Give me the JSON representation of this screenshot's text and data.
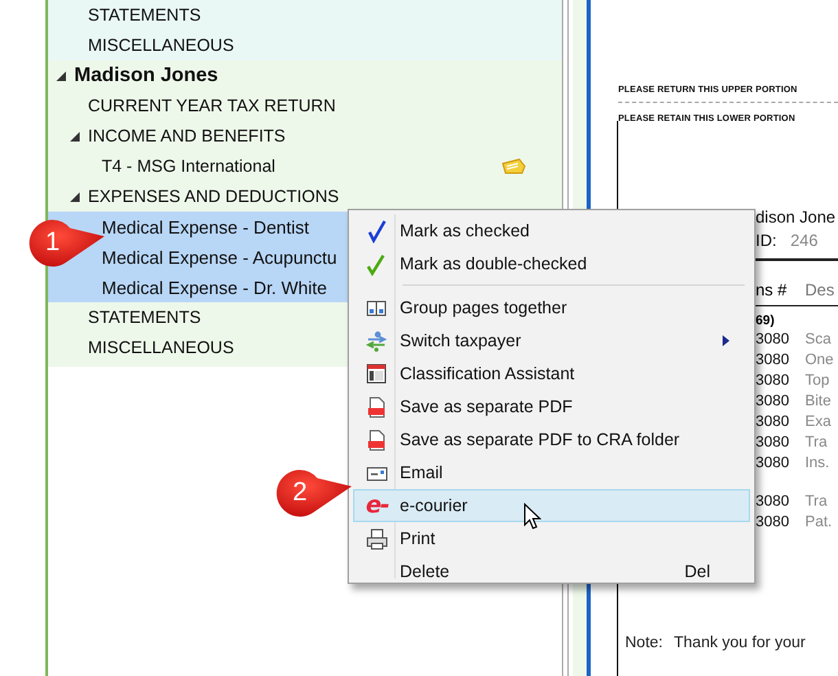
{
  "tree": {
    "previous_items": [
      {
        "label": "STATEMENTS",
        "selected": false
      },
      {
        "label": "MISCELLANEOUS",
        "selected": false
      }
    ],
    "taxpayers": [
      {
        "label": "Madison Jones",
        "expanded": true,
        "selected": false,
        "children": [
          {
            "label": "CURRENT YEAR TAX RETURN",
            "selected": false
          },
          {
            "label": "INCOME AND BENEFITS",
            "expanded": true,
            "selected": false,
            "children": [
              {
                "label": "T4 - MSG International",
                "selected": false,
                "tagged": true
              }
            ]
          },
          {
            "label": "EXPENSES AND DEDUCTIONS",
            "expanded": true,
            "selected": false,
            "children": [
              {
                "label": "Medical Expense - Dentist",
                "selected": true
              },
              {
                "label": "Medical Expense - Acupunctu",
                "selected": true
              },
              {
                "label": "Medical Expense - Dr. White",
                "selected": true
              }
            ]
          },
          {
            "label": "STATEMENTS",
            "selected": false
          },
          {
            "label": "MISCELLANEOUS",
            "selected": false
          }
        ]
      }
    ]
  },
  "context_menu": {
    "items": [
      {
        "kind": "check",
        "label": "Mark as checked",
        "selected": false
      },
      {
        "kind": "doublecheck",
        "label": "Mark as double-checked",
        "selected": false
      },
      {
        "kind": "separator"
      },
      {
        "kind": "group",
        "label": "Group pages together",
        "selected": false
      },
      {
        "kind": "switch",
        "label": "Switch taxpayer",
        "submenu": true,
        "selected": false
      },
      {
        "kind": "classify",
        "label": "Classification Assistant",
        "selected": false
      },
      {
        "kind": "pdf",
        "label": "Save as separate PDF",
        "selected": false
      },
      {
        "kind": "pdf",
        "label": "Save as separate PDF to CRA folder",
        "selected": false
      },
      {
        "kind": "email",
        "label": "Email",
        "selected": false
      },
      {
        "kind": "ecourier",
        "label": "e-courier",
        "icon_text": "e-",
        "selected": true
      },
      {
        "kind": "print",
        "label": "Print",
        "selected": false
      },
      {
        "kind": "plain",
        "label": "Delete",
        "shortcut": "Del",
        "selected": false
      }
    ]
  },
  "document": {
    "notices": [
      "PLEASE RETURN THIS UPPER PORTION",
      "PLEASE RETAIN THIS LOWER PORTION"
    ],
    "name": "dison Jone",
    "id_label": "ID:",
    "id_value": "246",
    "columns": [
      "ns #",
      "Des"
    ],
    "section": "69)",
    "row_groups": [
      [
        {
          "number": "3080",
          "description": "Sca"
        },
        {
          "number": "3080",
          "description": "One"
        },
        {
          "number": "3080",
          "description": "Top"
        },
        {
          "number": "3080",
          "description": "Bite"
        },
        {
          "number": "3080",
          "description": "Exa"
        },
        {
          "number": "3080",
          "description": "Tra"
        },
        {
          "number": "3080",
          "description": "Ins."
        }
      ],
      [
        {
          "number": "3080",
          "description": "Tra"
        },
        {
          "number": "3080",
          "description": "Pat."
        }
      ]
    ],
    "note_label": "Note:",
    "note": "Thank you for your"
  },
  "callouts": [
    {
      "label": "1"
    },
    {
      "label": "2"
    }
  ]
}
